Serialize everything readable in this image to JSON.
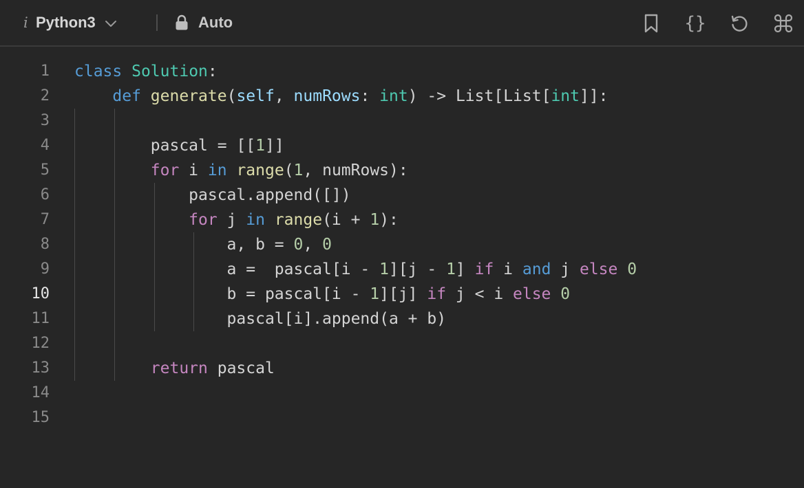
{
  "toolbar": {
    "info_glyph": "i",
    "language": "Python3",
    "mode": "Auto",
    "icons": [
      "info-icon",
      "chevron-down-icon",
      "lock-icon",
      "bookmark-icon",
      "braces-icon",
      "reset-icon",
      "command-icon"
    ]
  },
  "editor": {
    "active_line": 10,
    "line_numbers": [
      "1",
      "2",
      "3",
      "4",
      "5",
      "6",
      "7",
      "8",
      "9",
      "10",
      "11",
      "12",
      "13",
      "14",
      "15"
    ],
    "lines": [
      [
        {
          "t": "class",
          "c": "kw"
        },
        {
          "t": " "
        },
        {
          "t": "Solution",
          "c": "cls"
        },
        {
          "t": ":"
        }
      ],
      [
        {
          "t": "    "
        },
        {
          "t": "def",
          "c": "kw"
        },
        {
          "t": " "
        },
        {
          "t": "generate",
          "c": "fn"
        },
        {
          "t": "("
        },
        {
          "t": "self",
          "c": "var"
        },
        {
          "t": ", "
        },
        {
          "t": "numRows",
          "c": "var"
        },
        {
          "t": ": "
        },
        {
          "t": "int",
          "c": "cls"
        },
        {
          "t": ") -> List[List["
        },
        {
          "t": "int",
          "c": "cls"
        },
        {
          "t": "]]:"
        }
      ],
      [],
      [
        {
          "t": "        pascal = [["
        },
        {
          "t": "1",
          "c": "num"
        },
        {
          "t": "]]"
        }
      ],
      [
        {
          "t": "        "
        },
        {
          "t": "for",
          "c": "ctl"
        },
        {
          "t": " i "
        },
        {
          "t": "in",
          "c": "kw"
        },
        {
          "t": " "
        },
        {
          "t": "range",
          "c": "fn"
        },
        {
          "t": "("
        },
        {
          "t": "1",
          "c": "num"
        },
        {
          "t": ", numRows):"
        }
      ],
      [
        {
          "t": "            pascal.append([])"
        }
      ],
      [
        {
          "t": "            "
        },
        {
          "t": "for",
          "c": "ctl"
        },
        {
          "t": " j "
        },
        {
          "t": "in",
          "c": "kw"
        },
        {
          "t": " "
        },
        {
          "t": "range",
          "c": "fn"
        },
        {
          "t": "(i + "
        },
        {
          "t": "1",
          "c": "num"
        },
        {
          "t": "):"
        }
      ],
      [
        {
          "t": "                a, b = "
        },
        {
          "t": "0",
          "c": "num"
        },
        {
          "t": ", "
        },
        {
          "t": "0",
          "c": "num"
        }
      ],
      [
        {
          "t": "                a =  pascal[i - "
        },
        {
          "t": "1",
          "c": "num"
        },
        {
          "t": "][j - "
        },
        {
          "t": "1",
          "c": "num"
        },
        {
          "t": "] "
        },
        {
          "t": "if",
          "c": "ctl"
        },
        {
          "t": " i "
        },
        {
          "t": "and",
          "c": "kw"
        },
        {
          "t": " j "
        },
        {
          "t": "else",
          "c": "ctl"
        },
        {
          "t": " "
        },
        {
          "t": "0",
          "c": "num"
        }
      ],
      [
        {
          "t": "                b = pascal[i - "
        },
        {
          "t": "1",
          "c": "num"
        },
        {
          "t": "][j] "
        },
        {
          "t": "if",
          "c": "ctl"
        },
        {
          "t": " j < i "
        },
        {
          "t": "else",
          "c": "ctl"
        },
        {
          "t": " "
        },
        {
          "t": "0",
          "c": "num"
        }
      ],
      [
        {
          "t": "                pascal[i].append(a + b)"
        }
      ],
      [],
      [
        {
          "t": "        "
        },
        {
          "t": "return",
          "c": "ctl"
        },
        {
          "t": " pascal"
        }
      ],
      [],
      []
    ]
  }
}
